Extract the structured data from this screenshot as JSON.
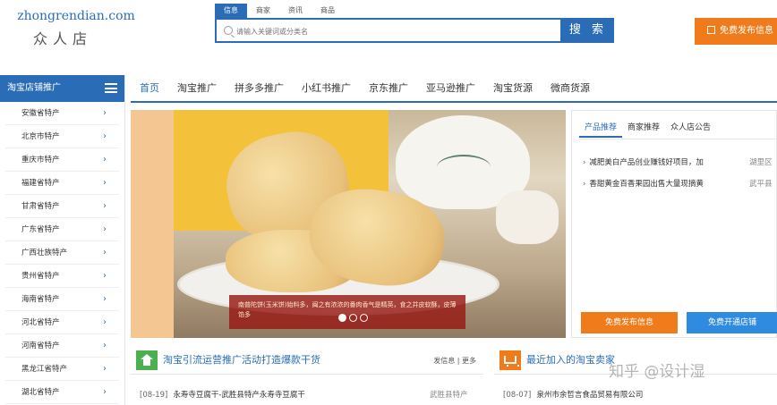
{
  "site": {
    "logo_en": "zhongrendian.com",
    "logo_cn": "众人店"
  },
  "search": {
    "tabs": [
      "信息",
      "商家",
      "资讯",
      "商品"
    ],
    "active_tab": "信息",
    "placeholder": "请输入关键词或分类名",
    "button_label": "搜 索"
  },
  "header": {
    "publish_label": "免费发布信息"
  },
  "nav": {
    "items": [
      "首页",
      "淘宝推广",
      "拼多多推广",
      "小红书推广",
      "京东推广",
      "亚马逊推广",
      "淘宝货源",
      "微商货源"
    ],
    "active": "首页"
  },
  "sidebar": {
    "title": "淘宝店铺推广",
    "items": [
      "安徽省特产",
      "北京市特产",
      "重庆市特产",
      "福建省特产",
      "甘肃省特产",
      "广东省特产",
      "广西壮族特产",
      "贵州省特产",
      "海南省特产",
      "河北省特产",
      "河南省特产",
      "黑龙江省特产",
      "湖北省特产"
    ]
  },
  "banner": {
    "caption": "南普陀饼(玉米饼)始料多，闽之有浓浓的番肉香气是精英，食之并皮软酥，皮薄馅多",
    "slides": 3,
    "active_slide": 1
  },
  "rpanel": {
    "tabs": [
      "产品推荐",
      "商家推荐",
      "众人店公告"
    ],
    "active_tab": "产品推荐",
    "news": [
      {
        "title": "减肥美白产品创业赚钱好项目，加",
        "loc": "湖里区"
      },
      {
        "title": "香甜黄金百香果园出售大量现摘黄",
        "loc": "武平县"
      }
    ],
    "btn_publish": "免费发布信息",
    "btn_open_shop": "免费开通店铺"
  },
  "sections": {
    "left": {
      "title": "淘宝引流运营推广活动打造爆款干货",
      "more": "发信息 | 更多",
      "rows": [
        {
          "date": "[08-19]",
          "title": "永寿寺豆腐干-武胜县特产永寿寺豆腐干",
          "loc": "武胜县特产"
        }
      ]
    },
    "right": {
      "title": "最近加入的淘宝卖家",
      "rows": [
        {
          "date": "[08-07]",
          "title": "泉州市余哲言食品贸易有限公司"
        }
      ]
    }
  },
  "watermark": "知乎 @设计湿",
  "colors": {
    "brand_blue": "#2a6cb6",
    "accent_orange": "#f07b1a",
    "open_shop_blue": "#2f8be0",
    "section_green": "#4cb050"
  }
}
